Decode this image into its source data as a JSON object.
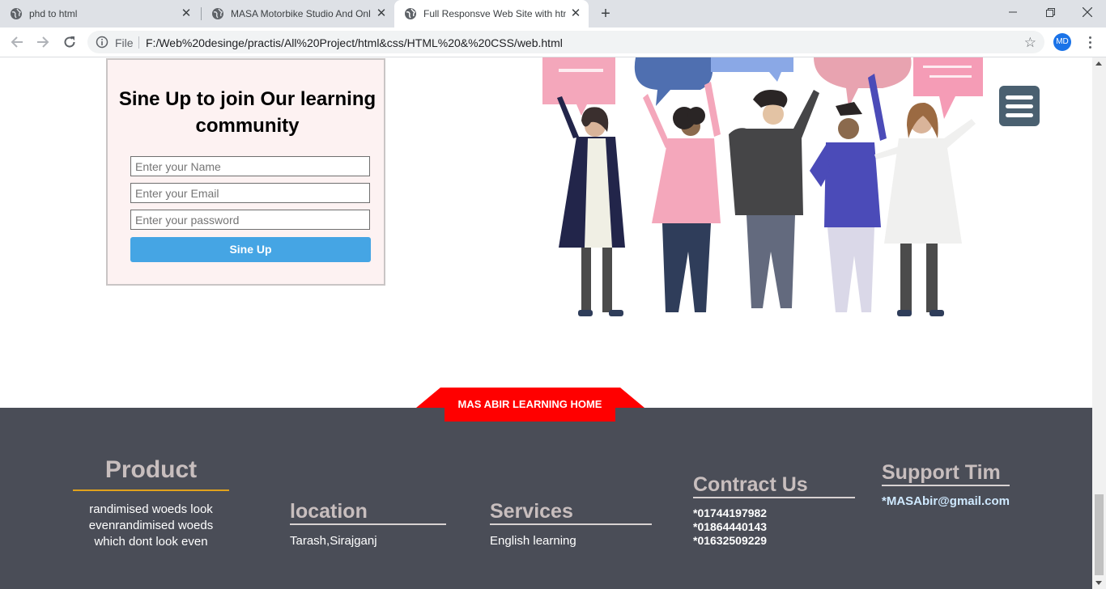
{
  "browser": {
    "tabs": [
      {
        "title": "phd to html",
        "active": false
      },
      {
        "title": "MASA Motorbike Studio And Onl",
        "active": false
      },
      {
        "title": "Full Responsve Web Site with htm",
        "active": true
      }
    ],
    "file_label": "File",
    "url": "F:/Web%20desinge/practis/All%20Project/html&css/HTML%20&%20CSS/web.html",
    "profile_initials": "MD"
  },
  "signup": {
    "title": "Sine Up to join Our learning community",
    "name_placeholder": "Enter your Name",
    "email_placeholder": "Enter your Email",
    "password_placeholder": "Enter your password",
    "button_label": "Sine Up"
  },
  "ribbon": {
    "label": "MAS ABIR LEARNING HOME"
  },
  "footer": {
    "product": {
      "heading": "Product",
      "lines": [
        "randimised woeds look",
        "evenrandimised woeds",
        "which dont look even"
      ]
    },
    "location": {
      "heading": "location",
      "text": "Tarash,Sirajganj"
    },
    "services": {
      "heading": "Services",
      "text": "English learning"
    },
    "contact": {
      "heading": "Contract Us",
      "phones": [
        "*01744197982",
        "*01864440143",
        "*01632509229"
      ]
    },
    "support": {
      "heading": "Support Tim",
      "email": "*MASAbir@gmail.com"
    }
  },
  "colors": {
    "footer_bg": "#4a4d57",
    "ribbon": "#ff0000",
    "button": "#45a5e4",
    "product_underline": "#e0a21c"
  },
  "icons": [
    "globe-icon",
    "close-icon",
    "plus-icon",
    "minimize-icon",
    "maximize-icon",
    "window-close-icon",
    "back-arrow-icon",
    "forward-arrow-icon",
    "reload-icon",
    "info-icon",
    "star-icon",
    "menu-icon",
    "hamburger-icon"
  ]
}
